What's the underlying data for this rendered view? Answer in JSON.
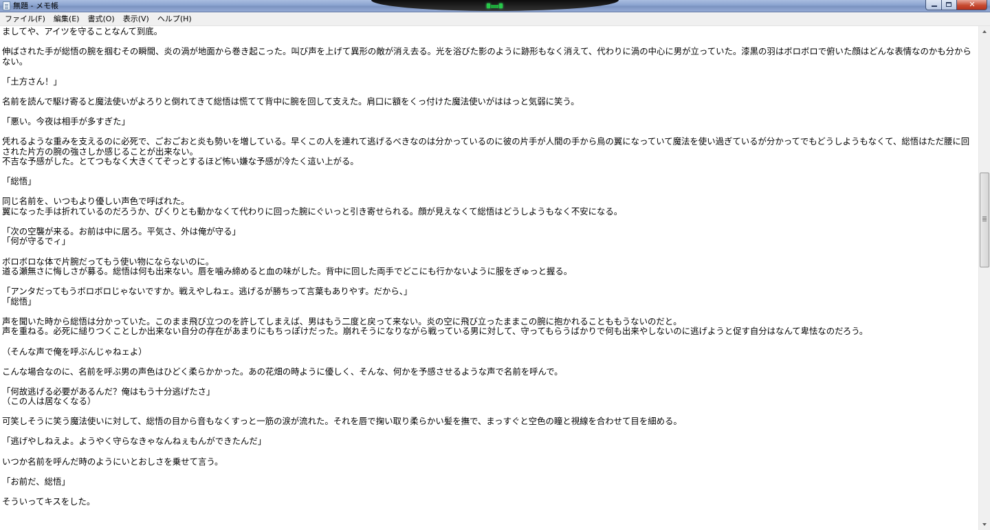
{
  "window": {
    "title": "無題 - メモ帳",
    "controls": {
      "close_glyph": "✕"
    }
  },
  "menu": {
    "items": [
      {
        "label": "ファイル(F)"
      },
      {
        "label": "編集(E)"
      },
      {
        "label": "書式(O)"
      },
      {
        "label": "表示(V)"
      },
      {
        "label": "ヘルプ(H)"
      }
    ]
  },
  "document": {
    "text": "ましてや、アイツを守ることなんて到底。\n\n伸ばされた手が総悟の腕を掴むその瞬間、炎の渦が地面から巻き起こった。叫び声を上げて異形の敵が消え去る。光を浴びた影のように跡形もなく消えて、代わりに渦の中心に男が立っていた。漆黒の羽はボロボロで俯いた顔はどんな表情なのかも分からない。\n\n「土方さん！」\n\n名前を読んで駆け寄ると魔法使いがよろりと倒れてきて総悟は慌てて背中に腕を回して支えた。肩口に額をくっ付けた魔法使いがははっと気弱に笑う。\n\n「悪い。今夜は相手が多すぎた」\n\n凭れるような重みを支えるのに必死で、ごおごおと炎も勢いを増している。早くこの人を連れて逃げるべきなのは分かっているのに彼の片手が人間の手から鳥の翼になっていて魔法を使い過ぎているが分かってでもどうしようもなくて、総悟はただ腰に回された片方の腕の強さしか感じることが出来ない。\n不吉な予感がした。とてつもなく大きくてぞっとするほど怖い嫌な予感が冷たく這い上がる。\n\n「総悟」\n\n同じ名前を、いつもより優しい声色で呼ばれた。\n翼になった手は折れているのだろうか、ぴくりとも動かなくて代わりに回った腕にぐいっと引き寄せられる。顔が見えなくて総悟はどうしようもなく不安になる。\n\n「次の空襲が来る。お前は中に居ろ。平気さ、外は俺が守る」\n「何が守るでィ」\n\nボロボロな体で片腕だってもう使い物にならないのに。\n道る瀬無さに悔しさが募る。総悟は何も出来ない。唇を噛み締めると血の味がした。背中に回した両手でどこにも行かないように服をぎゅっと握る。\n\n「アンタだってもうボロボロじゃないですか。戦えやしねェ。逃げるが勝ちって言葉もありやす。だから、」\n「総悟」\n\n声を聞いた時から総悟は分かっていた。このまま飛び立つのを許してしまえば、男はもう二度と戻って来ない。炎の空に飛び立ったままこの腕に抱かれることももうないのだと。\n声を重ねる。必死に縋りつくことしか出来ない自分の存在があまりにもちっぽけだった。崩れそうになりながら戦っている男に対して、守ってもらうばかりで何も出来やしないのに逃げようと促す自分はなんて卑怯なのだろう。\n\n（そんな声で俺を呼ぶんじゃねェよ）\n\nこんな場合なのに、名前を呼ぶ男の声色はひどく柔らかかった。あの花畑の時ように優しく、そんな、何かを予感させるような声で名前を呼んで。\n\n「何故逃げる必要があるんだ？俺はもう十分逃げたさ」\n（この人は居なくなる）\n\n可笑しそうに笑う魔法使いに対して、総悟の目から音もなくすっと一筋の涙が流れた。それを唇で掬い取り柔らかい髪を撫で、まっすぐと空色の瞳と視線を合わせて目を細める。\n\n「逃げやしねえよ。ようやく守らなきゃなんねぇもんができたんだ」\n\nいつか名前を呼んだ時のようにいとおしさを乗せて言う。\n\n「お前だ、総悟」\n\nそういってキスをした。"
  },
  "scrollbar": {
    "thumb_fraction": 0.42
  },
  "colors": {
    "titlebar": "#8aa3cf",
    "menubar_bg": "#f0f0f0",
    "text": "#000000",
    "close_button": "#c74b32"
  },
  "icons": [
    "notepad-icon",
    "minimize-icon",
    "maximize-icon",
    "close-icon",
    "scroll-up-arrow-icon",
    "scroll-down-arrow-icon"
  ]
}
